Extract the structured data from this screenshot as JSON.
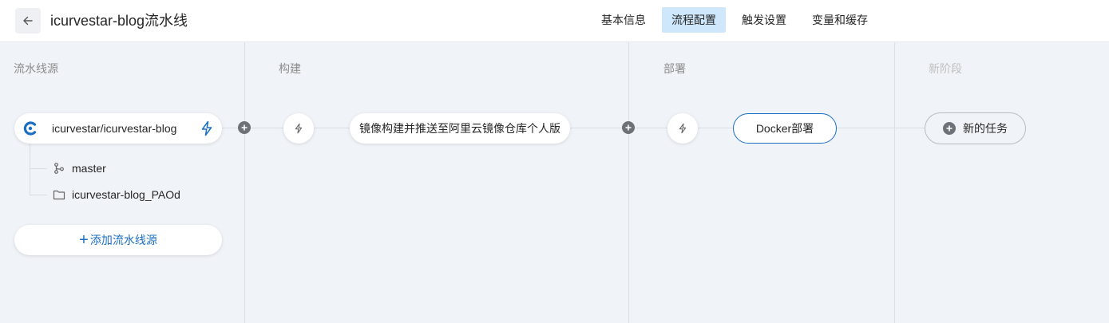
{
  "header": {
    "title": "icurvestar-blog流水线",
    "tabs": [
      {
        "label": "基本信息",
        "active": false
      },
      {
        "label": "流程配置",
        "active": true
      },
      {
        "label": "触发设置",
        "active": false
      },
      {
        "label": "变量和缓存",
        "active": false
      }
    ]
  },
  "stages": {
    "source": {
      "title": "流水线源"
    },
    "build": {
      "title": "构建"
    },
    "deploy": {
      "title": "部署"
    },
    "new": {
      "title": "新阶段"
    }
  },
  "source": {
    "repo": "icurvestar/icurvestar-blog",
    "branch": "master",
    "workspace": "icurvestar-blog_PAOd",
    "add_label": "添加流水线源"
  },
  "jobs": {
    "build_job": "镜像构建并推送至阿里云镜像仓库个人版",
    "deploy_job": "Docker部署",
    "new_task": "新的任务"
  },
  "colors": {
    "accent": "#1b6ec2",
    "active_tab_bg": "#cfe7fb",
    "canvas_bg": "#f0f3f7"
  },
  "icons": [
    "back-arrow-icon",
    "codeup-logo-icon",
    "lightning-icon",
    "branch-icon",
    "folder-icon",
    "plus-icon"
  ]
}
